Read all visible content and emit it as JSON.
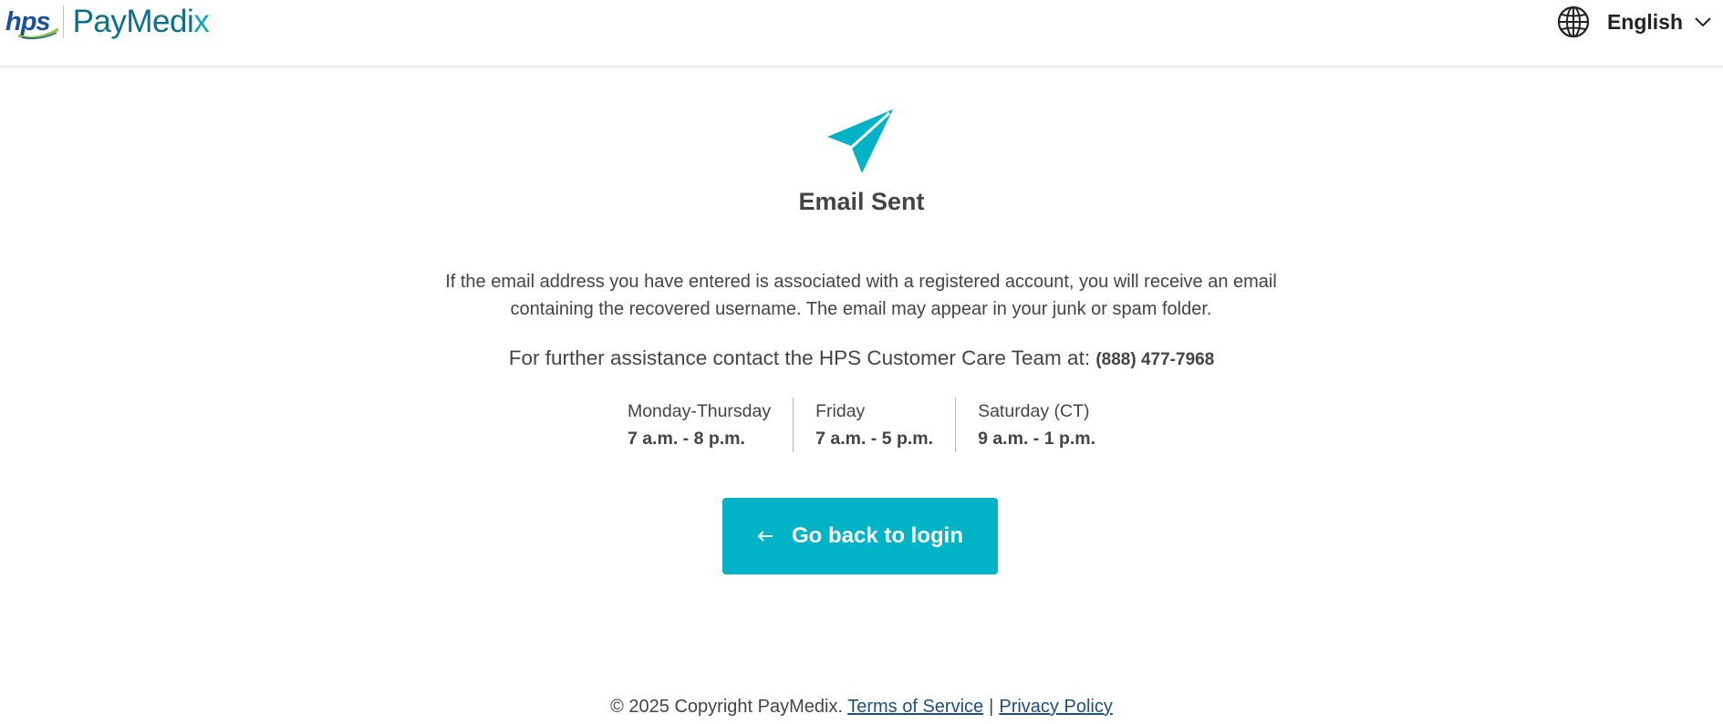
{
  "header": {
    "logo_hps": "hps",
    "logo_paymedix_main": "PayMedi",
    "logo_paymedix_x": "x",
    "language": {
      "label": "English",
      "icon": "globe-icon",
      "dropdown_icon": "chevron-down-icon"
    }
  },
  "main": {
    "icon": "paper-plane-icon",
    "title": "Email Sent",
    "message": "If the email address you have entered is associated with a registered account, you will receive an email containing the recovered username. The email may appear in your junk or spam folder.",
    "assist_text": "For further assistance contact the HPS Customer Care Team at:",
    "phone": "(888) 477-7968",
    "hours": [
      {
        "day": "Monday-Thursday",
        "time": "7 a.m. - 8 p.m."
      },
      {
        "day": "Friday",
        "time": "7 a.m. - 5 p.m."
      },
      {
        "day": "Saturday (CT)",
        "time": "9 a.m. - 1 p.m."
      }
    ],
    "back_button": {
      "label": "Go back to login",
      "icon": "arrow-left-icon"
    }
  },
  "footer": {
    "copyright": "© 2025 Copyright PayMedix.",
    "terms": "Terms of Service",
    "separator": "|",
    "privacy": "Privacy Policy"
  },
  "colors": {
    "accent": "#00b3c7",
    "brand_teal": "#0e6f8a",
    "hps_blue": "#1b4f9c",
    "text": "#444444",
    "link": "#1f4f7a"
  }
}
